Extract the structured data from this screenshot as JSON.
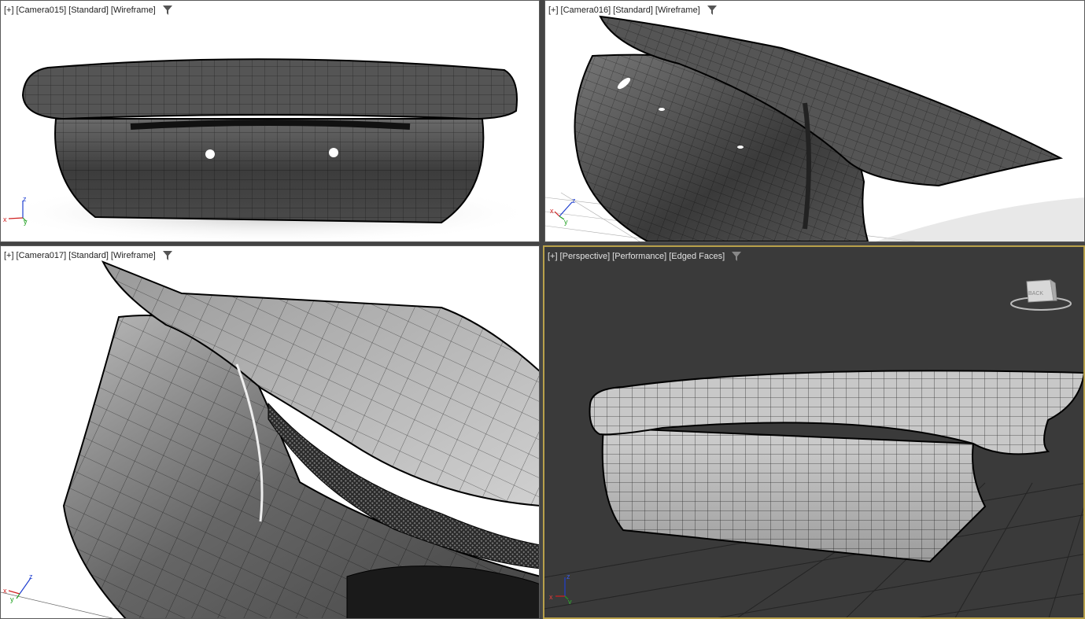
{
  "viewports": [
    {
      "id": "tl",
      "label": {
        "plus": "[+]",
        "camera": "[Camera015]",
        "shading": "[Standard]",
        "mode": "[Wireframe]"
      },
      "filter_icon": "funnel-icon",
      "axis": {
        "x": "x",
        "y": "y",
        "z": "z"
      }
    },
    {
      "id": "tr",
      "label": {
        "plus": "[+]",
        "camera": "[Camera016]",
        "shading": "[Standard]",
        "mode": "[Wireframe]"
      },
      "filter_icon": "funnel-icon",
      "axis": {
        "x": "x",
        "y": "y",
        "z": "z"
      }
    },
    {
      "id": "bl",
      "label": {
        "plus": "[+]",
        "camera": "[Camera017]",
        "shading": "[Standard]",
        "mode": "[Wireframe]"
      },
      "filter_icon": "funnel-icon",
      "axis": {
        "x": "x",
        "y": "y",
        "z": "z"
      }
    },
    {
      "id": "br",
      "label": {
        "plus": "[+]",
        "camera": "[Perspective]",
        "shading": "[Performance]",
        "mode": "[Edged Faces]"
      },
      "filter_icon": "funnel-icon",
      "axis": {
        "x": "x",
        "y": "y",
        "z": "z"
      },
      "viewcube_label": "BACK"
    }
  ],
  "colors": {
    "active_border": "#b8a04a",
    "dark_bg": "#3a3a3a",
    "light_bg": "#ffffff",
    "axis_x": "#d02020",
    "axis_y": "#20a020",
    "axis_z": "#2040d0"
  }
}
